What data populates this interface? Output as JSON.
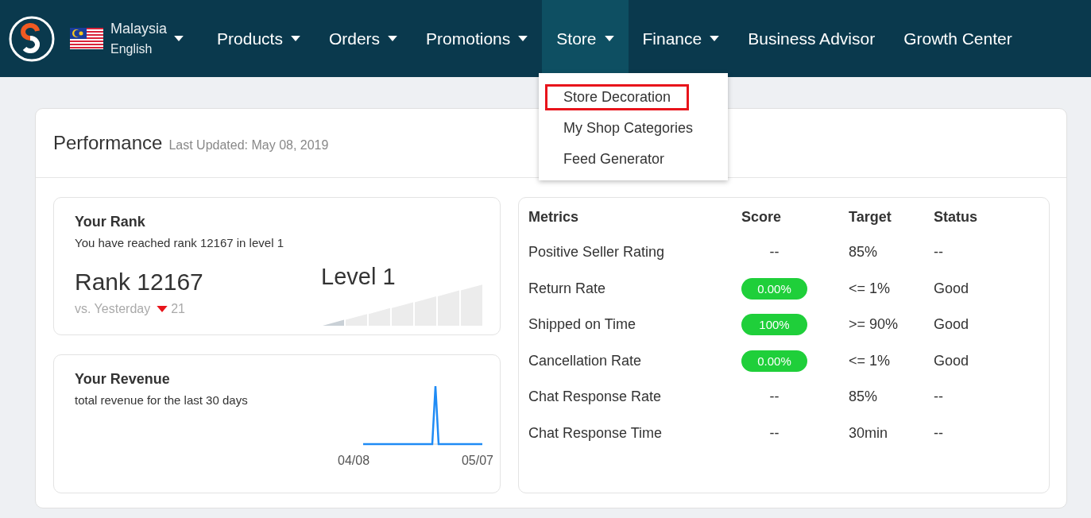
{
  "topbar": {
    "country": "Malaysia",
    "language": "English",
    "nav": [
      {
        "label": "Products",
        "dropdown": true,
        "selected": false
      },
      {
        "label": "Orders",
        "dropdown": true,
        "selected": false
      },
      {
        "label": "Promotions",
        "dropdown": true,
        "selected": false
      },
      {
        "label": "Store",
        "dropdown": true,
        "selected": true
      },
      {
        "label": "Finance",
        "dropdown": true,
        "selected": false
      },
      {
        "label": "Business Advisor",
        "dropdown": false,
        "selected": false
      },
      {
        "label": "Growth Center",
        "dropdown": false,
        "selected": false
      }
    ]
  },
  "store_menu": [
    {
      "label": "Store Decoration",
      "highlighted": true
    },
    {
      "label": "My Shop Categories",
      "highlighted": false
    },
    {
      "label": "Feed Generator",
      "highlighted": false
    }
  ],
  "performance": {
    "title": "Performance",
    "updated": "Last Updated: May 08, 2019",
    "rank": {
      "title": "Your Rank",
      "subtitle": "You have reached rank 12167 in level 1",
      "rank": "Rank 12167",
      "compare": "vs. Yesterday",
      "change": "21",
      "decreased": true,
      "level_label": "Level 1",
      "level": 0.14
    },
    "revenue": {
      "title": "Your Revenue",
      "subtitle": "total revenue for the last 30 days",
      "start": "04/08",
      "end": "05/07"
    },
    "metrics": {
      "columns": [
        "Metrics",
        "Score",
        "Target",
        "Status"
      ],
      "rows": [
        {
          "metric": "Positive Seller Rating",
          "score": "--",
          "kind": "plain",
          "target": "85%",
          "status": "--"
        },
        {
          "metric": "Return Rate",
          "score": "0.00%",
          "kind": "pill",
          "target": "<= 1%",
          "status": "Good"
        },
        {
          "metric": "Shipped on Time",
          "score": "100%",
          "kind": "pill",
          "target": ">= 90%",
          "status": "Good"
        },
        {
          "metric": "Cancellation Rate",
          "score": "0.00%",
          "kind": "pill",
          "target": "<= 1%",
          "status": "Good"
        },
        {
          "metric": "Chat Response Rate",
          "score": "--",
          "kind": "plain",
          "target": "85%",
          "status": "--"
        },
        {
          "metric": "Chat Response Time",
          "score": "--",
          "kind": "plain",
          "target": "30min",
          "status": "--"
        }
      ]
    }
  }
}
